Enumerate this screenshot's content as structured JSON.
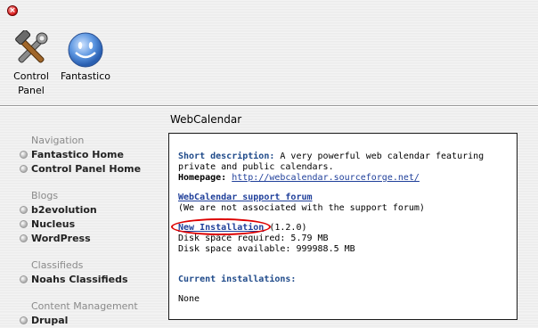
{
  "window": {
    "close_glyph": "×"
  },
  "toolbar": {
    "items": [
      {
        "label_line1": "Control",
        "label_line2": "Panel",
        "icon": "tools-icon"
      },
      {
        "label_line1": "Fantastico",
        "icon": "smiley-icon"
      }
    ]
  },
  "page": {
    "title": "WebCalendar"
  },
  "sidebar": {
    "sections": [
      {
        "title": "Navigation",
        "items": [
          "Fantastico Home",
          "Control Panel Home"
        ]
      },
      {
        "title": "Blogs",
        "items": [
          "b2evolution",
          "Nucleus",
          "WordPress"
        ]
      },
      {
        "title": "Classifieds",
        "items": [
          "Noahs Classifieds"
        ]
      },
      {
        "title": "Content Management",
        "items": [
          "Drupal"
        ]
      }
    ]
  },
  "panel": {
    "short_desc_label": "Short description:",
    "short_desc_text": " A very powerful web calendar featuring private and public calendars.",
    "homepage_label": "Homepage:",
    "homepage_url": "http://webcalendar.sourceforge.net/",
    "forum_link": "WebCalendar support forum",
    "forum_note": "(We are not associated with the support forum)",
    "new_install_link": "New Installation",
    "version": " (1.2.0)",
    "disk_required": "Disk space required: 5.79 MB",
    "disk_available": "Disk space available: 999988.5 MB",
    "current_label": "Current installations:",
    "current_value": "None"
  },
  "colors": {
    "accent_blue": "#1f4a8a",
    "highlight_red": "#dd0000"
  }
}
